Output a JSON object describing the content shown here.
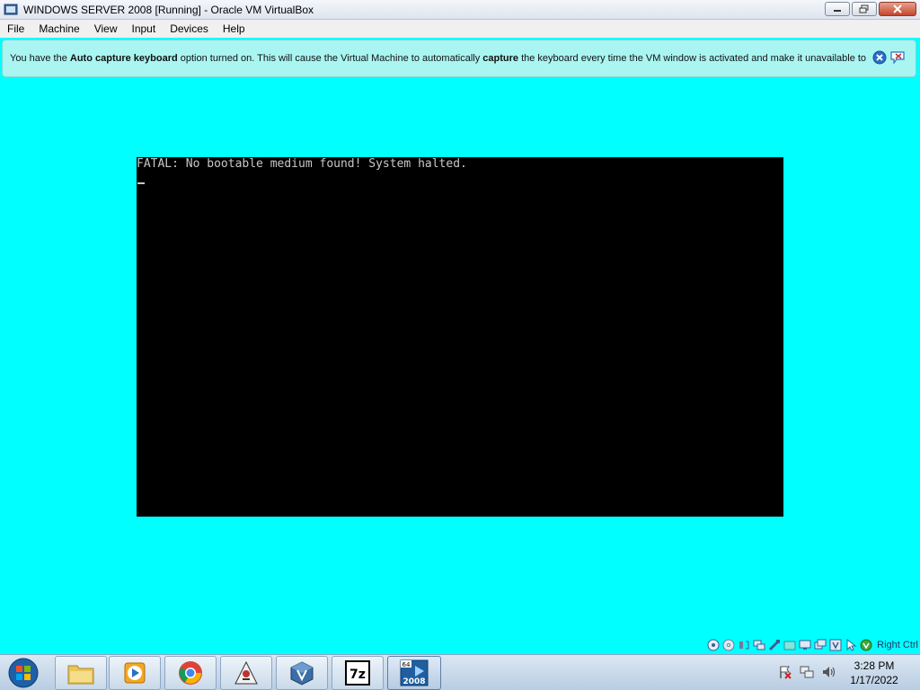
{
  "window": {
    "title": "WINDOWS SERVER 2008 [Running] - Oracle VM VirtualBox"
  },
  "menu": {
    "items": [
      "File",
      "Machine",
      "View",
      "Input",
      "Devices",
      "Help"
    ]
  },
  "banner": {
    "text_1": "You have the ",
    "bold_1": "Auto capture keyboard",
    "text_2": " option turned on. This will cause the Virtual Machine to automatically ",
    "bold_2": "capture",
    "text_3": " the keyboard every time the VM window is activated and make it unavailable to"
  },
  "vm": {
    "message": "FATAL: No bootable medium found! System halted."
  },
  "statusbar": {
    "host_key": "Right Ctrl",
    "icons": [
      "hard-disk-icon",
      "optical-drive-icon",
      "audio-icon",
      "network-icon",
      "usb-icon",
      "shared-folders-icon",
      "display-icon",
      "video-capture-icon",
      "virtualization-icon",
      "mouse-integration-icon",
      "keyboard-capture-icon"
    ]
  },
  "taskbar": {
    "apps": [
      "windows-explorer-icon",
      "media-player-icon",
      "chrome-icon",
      "java-icon",
      "virtualbox-icon",
      "7zip-icon",
      "windows-server-2008-icon"
    ],
    "sevenzip_label": "7z",
    "server_label_top": "64",
    "server_label_bottom": "2008",
    "time": "3:28 PM",
    "date": "1/17/2022"
  },
  "colors": {
    "vm_background": "#00ffff",
    "vm_screen": "#000000",
    "console_text": "#c8c8c8"
  }
}
